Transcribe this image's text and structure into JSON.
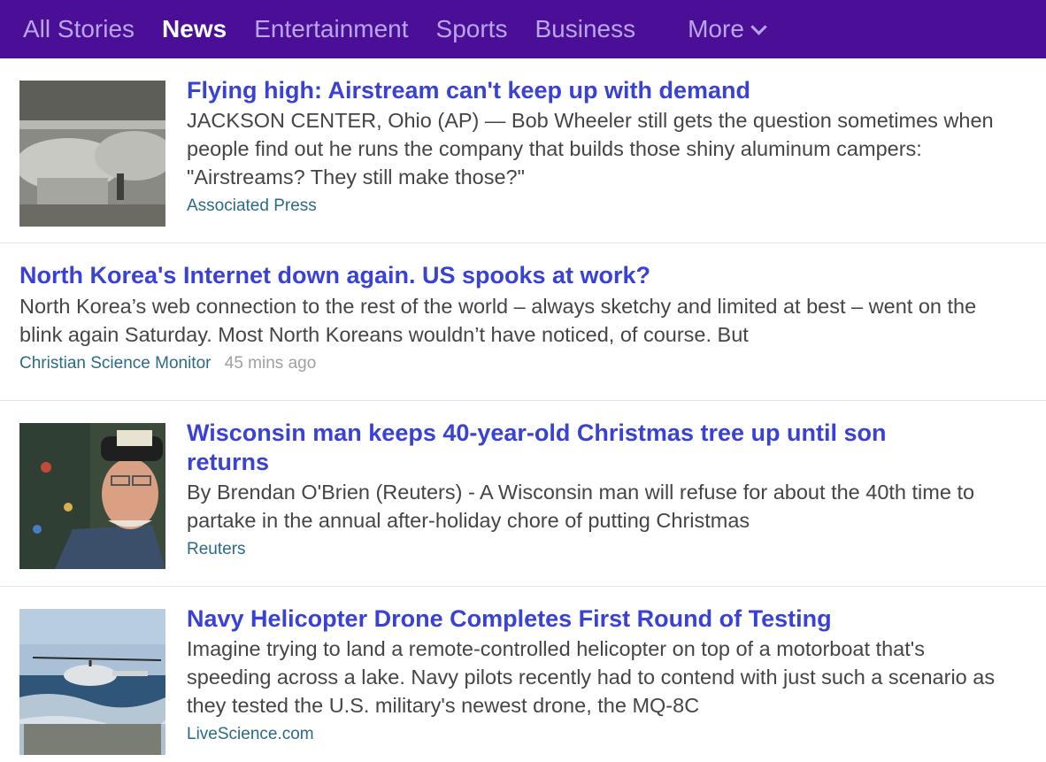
{
  "nav": {
    "items": [
      "All Stories",
      "News",
      "Entertainment",
      "Sports",
      "Business"
    ],
    "active": "News",
    "more_label": "More"
  },
  "stories": [
    {
      "title": "Flying high: Airstream can't keep up with demand",
      "summary": "JACKSON CENTER, Ohio (AP) — Bob Wheeler still gets the question sometimes when people find out he runs the company that builds those shiny aluminum campers: \"Airstreams? They still make those?\"",
      "source": "Associated Press",
      "time": ""
    },
    {
      "title": "North Korea's Internet down again. US spooks at work?",
      "summary": "North Korea’s web connection to the rest of the world – always sketchy and limited at best – went on the blink again Saturday. Most North Koreans wouldn’t have noticed, of course. But",
      "source": "Christian Science Monitor",
      "time": "45 mins ago"
    },
    {
      "title": "Wisconsin man keeps 40-year-old Christmas tree up until son returns",
      "summary": "By Brendan O'Brien (Reuters) - A Wisconsin man will refuse for about the 40th time to partake in the annual after-holiday chore of putting Christmas",
      "source": "Reuters",
      "time": ""
    },
    {
      "title": "Navy Helicopter Drone Completes First Round of Testing",
      "summary": "Imagine trying to land a remote-controlled helicopter on top of a motorboat that's speeding across a lake. Navy pilots recently had to contend with just such a scenario as they tested the U.S. military's newest drone, the MQ-8C",
      "source": "LiveScience.com",
      "time": ""
    }
  ]
}
